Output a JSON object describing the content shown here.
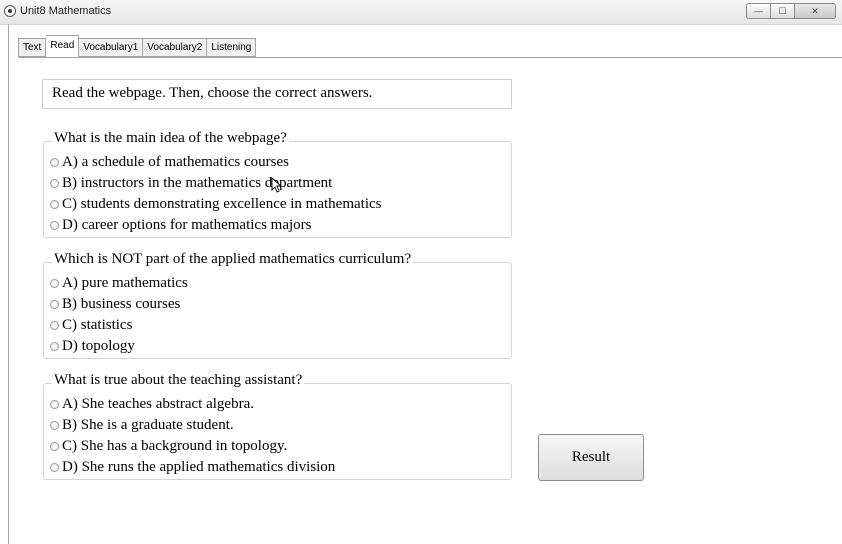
{
  "window": {
    "title": "Unit8 Mathematics",
    "controls": {
      "minimize": "—",
      "maximize": "☐",
      "close": "✕"
    }
  },
  "tabs": [
    {
      "label": "Text"
    },
    {
      "label": "Read",
      "active": true
    },
    {
      "label": "Vocabulary1"
    },
    {
      "label": "Vocabulary2"
    },
    {
      "label": "Listening"
    }
  ],
  "instructions": "Read the webpage. Then, choose the correct answers.",
  "questions": [
    {
      "prompt": "What is the main idea of the webpage?",
      "options": [
        "A) a schedule of mathematics courses",
        "B) instructors in the mathematics department",
        "C) students demonstrating excellence in mathematics",
        "D) career options for mathematics majors"
      ]
    },
    {
      "prompt": "Which is NOT part of the applied mathematics curriculum?",
      "options": [
        "A) pure mathematics",
        "B) business courses",
        "C) statistics",
        "D) topology"
      ]
    },
    {
      "prompt": "What is true about the teaching assistant?",
      "options": [
        "A) She teaches abstract algebra.",
        "B) She is a graduate student.",
        "C) She has a background in topology.",
        "D) She runs the applied mathematics division"
      ]
    }
  ],
  "result_button": "Result"
}
